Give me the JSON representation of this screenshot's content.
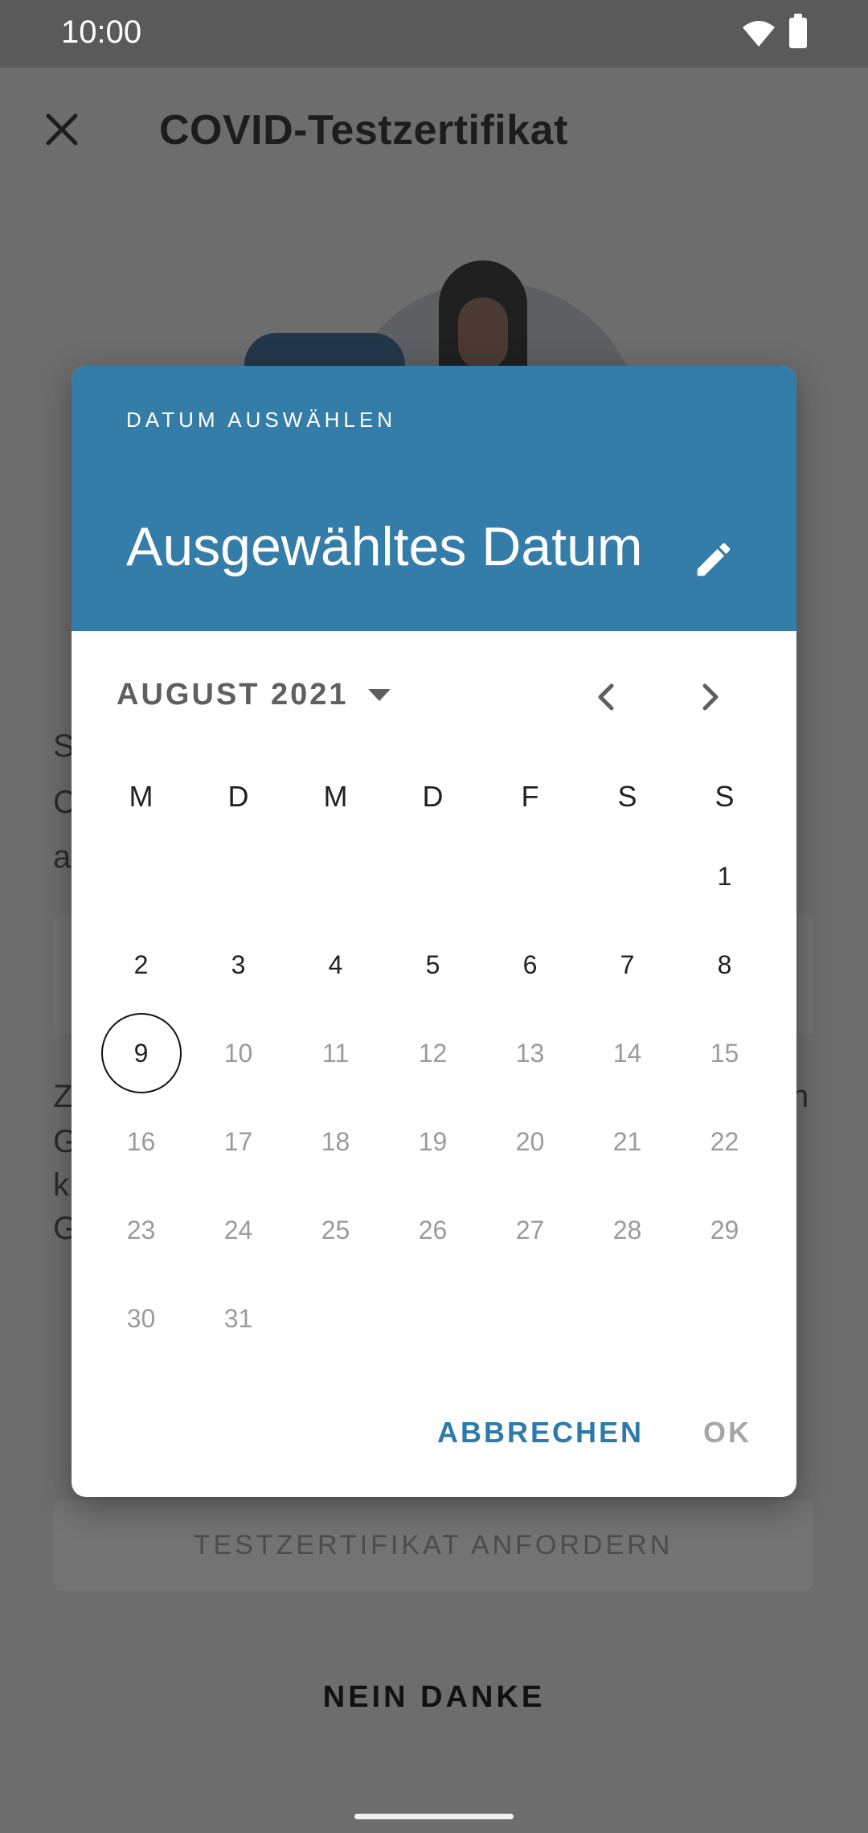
{
  "status_bar": {
    "time": "10:00"
  },
  "app_bar": {
    "title": "COVID-Testzertifikat"
  },
  "background": {
    "left_letters": [
      "S",
      "C",
      "a",
      "Z",
      "G",
      "k",
      "G"
    ],
    "right_letter": "n",
    "link_char": "",
    "request_button": "TESTZERTIFIKAT ANFORDERN",
    "no_thanks_button": "NEIN DANKE"
  },
  "dialog": {
    "overline": "DATUM AUSWÄHLEN",
    "headline": "Ausgewähltes Datum",
    "month_year": "AUGUST 2021",
    "weekdays": [
      "M",
      "D",
      "M",
      "D",
      "F",
      "S",
      "S"
    ],
    "weeks": [
      [
        "",
        "",
        "",
        "",
        "",
        "",
        "1"
      ],
      [
        "2",
        "3",
        "4",
        "5",
        "6",
        "7",
        "8"
      ],
      [
        "9",
        "10",
        "11",
        "12",
        "13",
        "14",
        "15"
      ],
      [
        "16",
        "17",
        "18",
        "19",
        "20",
        "21",
        "22"
      ],
      [
        "23",
        "24",
        "25",
        "26",
        "27",
        "28",
        "29"
      ],
      [
        "30",
        "31",
        "",
        "",
        "",
        "",
        ""
      ]
    ],
    "today": "9",
    "cancel_label": "ABBRECHEN",
    "ok_label": "OK"
  },
  "colors": {
    "header": "#357da9",
    "accent": "#2e7aab",
    "scrim": "#6d6d6d"
  },
  "icons": [
    "close-icon",
    "edit-pencil-icon",
    "dropdown-arrow-icon",
    "chevron-left-icon",
    "chevron-right-icon",
    "wifi-icon",
    "battery-icon"
  ]
}
